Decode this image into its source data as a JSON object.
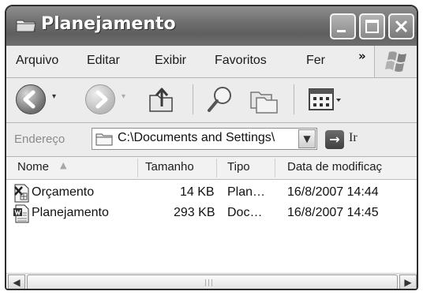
{
  "window": {
    "title": "Planejamento",
    "icon": "folder-icon"
  },
  "menubar": {
    "items": [
      "Arquivo",
      "Editar",
      "Exibir",
      "Favoritos",
      "Fer"
    ],
    "overflow": "»"
  },
  "toolbar": {
    "back_icon": "back-arrow-icon",
    "forward_icon": "forward-arrow-icon",
    "up_icon": "up-folder-icon",
    "search_icon": "search-icon",
    "folders_icon": "folders-icon",
    "views_icon": "views-icon"
  },
  "address": {
    "label": "Endereço",
    "value": "C:\\Documents and Settings\\",
    "go_label": "Ir"
  },
  "list": {
    "columns": [
      "Nome",
      "Tamanho",
      "Tipo",
      "Data de modificaç"
    ],
    "rows": [
      {
        "name": "Orçamento",
        "size": "14 KB",
        "type": "Plan…",
        "date": "16/8/2007 14:44",
        "icon": "spreadsheet-file-icon"
      },
      {
        "name": "Planejamento",
        "size": "293 KB",
        "type": "Doc…",
        "date": "16/8/2007 14:45",
        "icon": "document-file-icon"
      }
    ]
  },
  "colors": {
    "titlebar": "#6f6f6f",
    "background": "#ececec"
  }
}
